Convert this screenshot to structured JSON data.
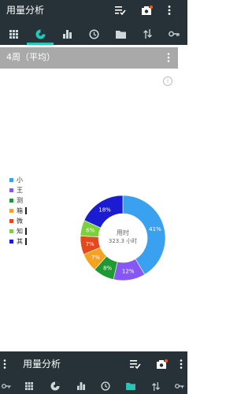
{
  "app": {
    "title": "用量分析"
  },
  "section": {
    "title": "4周（平均）"
  },
  "chart_data": {
    "type": "pie",
    "donut": true,
    "center_label": "用时",
    "center_value": "323.3 小时",
    "slices": [
      {
        "label": "41%",
        "value": 41,
        "color": "#3aa0f0"
      },
      {
        "label": "12%",
        "value": 12,
        "color": "#8657f5"
      },
      {
        "label": "8%",
        "value": 8,
        "color": "#1f9a32"
      },
      {
        "label": "7%",
        "value": 7,
        "color": "#f5a21f"
      },
      {
        "label": "7%",
        "value": 7,
        "color": "#e04a1c"
      },
      {
        "label": "6%",
        "value": 6,
        "color": "#7ad13a"
      },
      {
        "label": "18%",
        "value": 18,
        "color": "#1b1cd2"
      }
    ],
    "legend": [
      {
        "label": "小",
        "color": "#3aa0f0"
      },
      {
        "label": "王",
        "color": "#8657f5"
      },
      {
        "label": "测",
        "color": "#1f9a32"
      },
      {
        "label": "箱",
        "color": "#f5a21f"
      },
      {
        "label": "微",
        "color": "#e04a1c"
      },
      {
        "label": "知",
        "color": "#7ad13a"
      },
      {
        "label": "其",
        "color": "#1b1cd2"
      }
    ]
  },
  "colors": {
    "bar": "#263238",
    "accent": "#26c6b8",
    "section": "#a9a9a9"
  },
  "icons": {
    "top": [
      "checklist-icon",
      "camera-icon",
      "more-vert-icon"
    ],
    "tabs": [
      "grid-icon",
      "pie-chart-icon",
      "bar-chart-icon",
      "history-icon",
      "folder-icon",
      "sort-icon",
      "key-icon"
    ]
  }
}
